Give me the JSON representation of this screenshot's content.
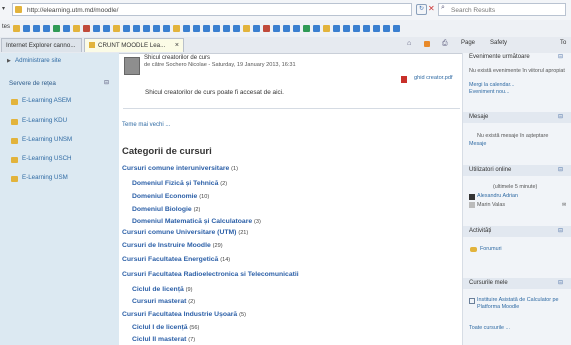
{
  "browser": {
    "url": "http://elearning.utm.md/moodle/",
    "search_placeholder": "Search Results",
    "fav_label": "tes",
    "tabs": [
      {
        "label": "Internet Explorer canno..."
      },
      {
        "label": "CRUNT MOODLE Lea..."
      }
    ],
    "tab_close": "×",
    "commands": {
      "page": "Page",
      "safety": "Safety",
      "tools": "To"
    }
  },
  "left": {
    "admin_label": "Administrare site",
    "servers_title": "Servere de rețea",
    "servers": [
      "E-Learning ASEM",
      "E-Learning KDU",
      "E-Learning UNSM",
      "E-Learning USCH",
      "E-Learning USM"
    ]
  },
  "news": {
    "title": "Shicul creatorilor de curs",
    "meta": "de către Sochero Nicolae - Saturday, 19 January 2013, 16:31",
    "attachment": "ghid creator.pdf",
    "body": "Shicul creatorilor de curs poate fi accesat de aici.",
    "older": "Teme mai vechi ..."
  },
  "categories": {
    "heading": "Categorii de cursuri",
    "items": [
      {
        "name": "Cursuri comune interuniversitare",
        "count": "(1)",
        "level": 1
      },
      {
        "name": "Domeniul Fizică și Tehnică",
        "count": "(2)",
        "level": 2
      },
      {
        "name": "Domeniul Economie",
        "count": "(10)",
        "level": 2
      },
      {
        "name": "Domeniul Biologie",
        "count": "(2)",
        "level": 2
      },
      {
        "name": "Domeniul Matematică și Calculatoare",
        "count": "(3)",
        "level": 2
      },
      {
        "name": "Cursuri comune Universitare (UTM)",
        "count": "(21)",
        "level": 1
      },
      {
        "name": "Cursuri de Instruire Moodle",
        "count": "(29)",
        "level": 1
      },
      {
        "name": "Cursuri Facultatea Energetică",
        "count": "(14)",
        "level": 1
      },
      {
        "name": "Cursuri Facultatea Radioelectronica si Telecomunicatii",
        "count": "",
        "level": 1
      },
      {
        "name": "Ciclul de licență",
        "count": "(9)",
        "level": 2
      },
      {
        "name": "Cursuri masterat",
        "count": "(2)",
        "level": 2
      },
      {
        "name": "Cursuri Facultatea Industrie Ușoară",
        "count": "(5)",
        "level": 1
      },
      {
        "name": "Ciclul I de licență",
        "count": "(56)",
        "level": 2
      },
      {
        "name": "Ciclul II masterat",
        "count": "(7)",
        "level": 2
      }
    ]
  },
  "right": {
    "events": {
      "title": "Evenimente următoare",
      "text": "Nu există evenimente în viitorul apropiat",
      "link1": "Mergi la calendar...",
      "link2": "Eveniment nou..."
    },
    "messages": {
      "title": "Mesaje",
      "text": "Nu există mesaje în așteptare",
      "link": "Mesaje"
    },
    "users": {
      "title": "Utilizatori online",
      "sub": "(ultimele 5 minute)",
      "list": [
        "Alexandru Adrian",
        "Marin Valas"
      ]
    },
    "activities": {
      "title": "Activități",
      "forum": "Forumuri"
    },
    "my_courses": {
      "title": "Cursurile mele",
      "course": "Instituire Asistată de Calculator pe Platforma Moodle",
      "all": "Toate cursurile ..."
    }
  },
  "colors": {
    "link": "#2b5fa7",
    "left_bg": "#dce9f2",
    "accent": "#e2b33c"
  }
}
